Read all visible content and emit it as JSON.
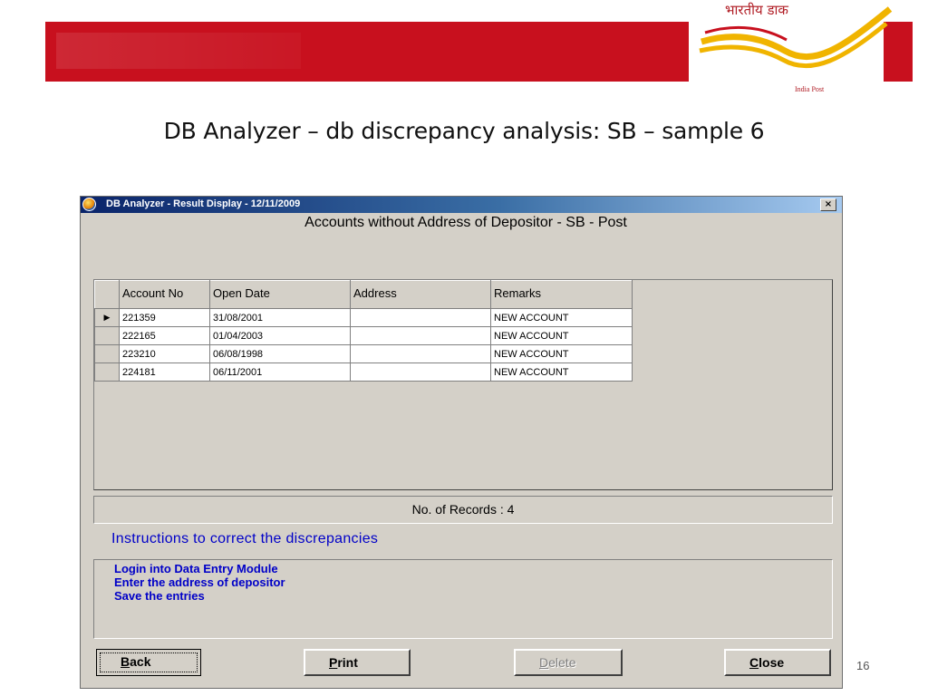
{
  "header": {
    "logo_hindi": "भारतीय डाक",
    "logo_english": "India Post",
    "logo_colors": {
      "red": "#c8101e",
      "gold": "#f0b400"
    }
  },
  "slide": {
    "title": "DB Analyzer – db discrepancy analysis: SB – sample 6",
    "page_number": "16"
  },
  "window": {
    "title": "DB Analyzer - Result Display - 12/11/2009",
    "close_symbol": "×",
    "heading": "Accounts without Address of Depositor - SB - Post"
  },
  "grid": {
    "columns": [
      "Account No",
      "Open Date",
      "Address",
      "Remarks"
    ],
    "rows": [
      {
        "indicator": "▶",
        "account_no": "221359",
        "open_date": "31/08/2001",
        "address": "",
        "remarks": "NEW ACCOUNT"
      },
      {
        "indicator": "",
        "account_no": "222165",
        "open_date": "01/04/2003",
        "address": "",
        "remarks": "NEW ACCOUNT"
      },
      {
        "indicator": "",
        "account_no": "223210",
        "open_date": "06/08/1998",
        "address": "",
        "remarks": "NEW ACCOUNT"
      },
      {
        "indicator": "",
        "account_no": "224181",
        "open_date": "06/11/2001",
        "address": "",
        "remarks": "NEW ACCOUNT"
      }
    ]
  },
  "records": "No. of Records : 4",
  "instructions": {
    "title": "Instructions to correct the discrepancies",
    "steps": [
      "Login into Data Entry Module",
      "Enter the address of depositor",
      "Save the entries"
    ]
  },
  "buttons": {
    "back": {
      "accel": "B",
      "rest": "ack"
    },
    "print": {
      "accel": "P",
      "rest": "rint"
    },
    "delete": {
      "accel": "D",
      "rest": "elete",
      "disabled": true
    },
    "close": {
      "accel": "C",
      "rest": "lose"
    }
  }
}
